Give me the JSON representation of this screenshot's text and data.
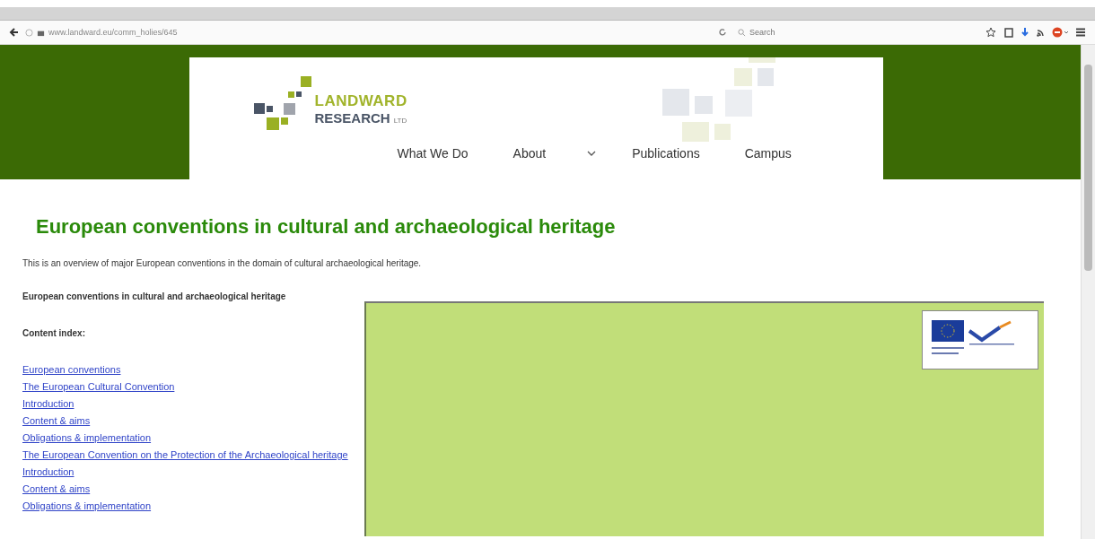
{
  "browser": {
    "address": "www.landward.eu/comm_holies/645",
    "search_placeholder": "Search"
  },
  "site": {
    "logo": {
      "name": "LANDWARD",
      "sub": "RESEARCH",
      "suffix": "LTD"
    },
    "nav": [
      {
        "label": "What We Do",
        "has_menu": false
      },
      {
        "label": "About",
        "has_menu": true
      },
      {
        "label": "Publications",
        "has_menu": false
      },
      {
        "label": "Campus",
        "has_menu": false
      }
    ]
  },
  "article": {
    "title": "European conventions in cultural and archaeological heritage",
    "intro": "This is an overview of major European conventions in the domain of cultural archaeological heritage.",
    "subtitle": "European conventions in cultural and archaeological heritage",
    "index_label": "Content index:",
    "index_links": [
      "European conventions",
      "The European Cultural Convention",
      "Introduction",
      "Content & aims",
      "Obligations & implementation",
      "The European Convention on the Protection of the Archaeological heritage",
      "Introduction",
      "Content & aims",
      "Obligations & implementation"
    ]
  }
}
